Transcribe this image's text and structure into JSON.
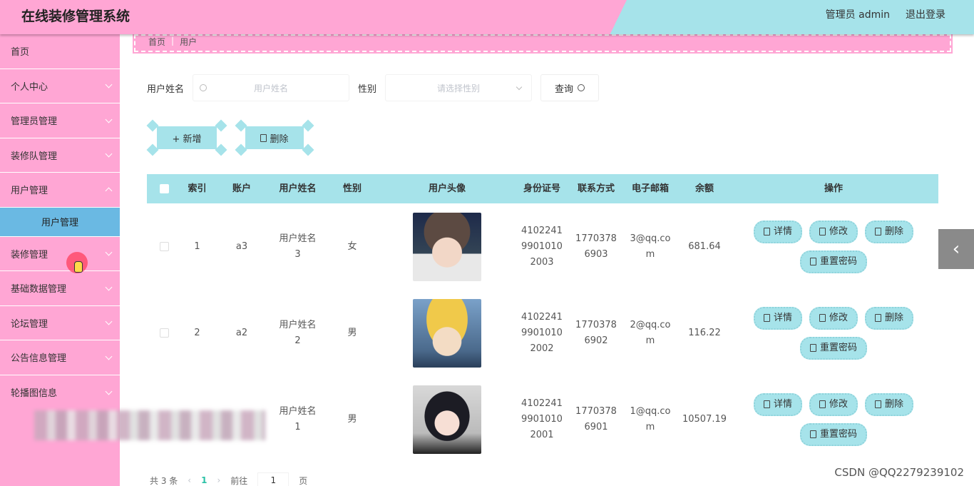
{
  "app": {
    "title": "在线装修管理系统"
  },
  "header": {
    "user_label": "管理员 admin",
    "logout_label": "退出登录"
  },
  "sidebar": {
    "items": [
      {
        "label": "首页"
      },
      {
        "label": "个人中心"
      },
      {
        "label": "管理员管理"
      },
      {
        "label": "装修队管理"
      },
      {
        "label": "用户管理"
      }
    ],
    "sub_item": "用户管理",
    "items2": [
      {
        "label": "装修管理"
      },
      {
        "label": "基础数据管理"
      },
      {
        "label": "论坛管理"
      },
      {
        "label": "公告信息管理"
      },
      {
        "label": "轮播图信息"
      }
    ]
  },
  "breadcrumb": {
    "home": "首页",
    "current": "用户",
    "separator": "|"
  },
  "search": {
    "name_label": "用户姓名",
    "name_placeholder": "用户姓名",
    "gender_label": "性别",
    "gender_placeholder": "请选择性别",
    "query_label": "查询"
  },
  "actions": {
    "add_label": "+ 新增",
    "delete_label": "删除"
  },
  "table": {
    "headers": [
      "索引",
      "账户",
      "用户姓名",
      "性别",
      "用户头像",
      "身份证号",
      "联系方式",
      "电子邮箱",
      "余额",
      "操作"
    ],
    "rows": [
      {
        "index": "1",
        "account": "a3",
        "name": "用户姓名3",
        "gender": "女",
        "id_card": "410224199010102003",
        "phone": "17703786903",
        "email": "3@qq.com",
        "balance": "681.64"
      },
      {
        "index": "2",
        "account": "a2",
        "name": "用户姓名2",
        "gender": "男",
        "id_card": "410224199010102002",
        "phone": "17703786902",
        "email": "2@qq.com",
        "balance": "116.22"
      },
      {
        "index": "",
        "account": "",
        "name": "用户姓名1",
        "gender": "男",
        "id_card": "410224199010102001",
        "phone": "17703786901",
        "email": "1@qq.com",
        "balance": "10507.19"
      }
    ],
    "op_labels": {
      "detail": "详情",
      "edit": "修改",
      "delete": "删除",
      "reset": "重置密码"
    }
  },
  "pager": {
    "total": "共 3 条",
    "current_page": "1",
    "goto_label": "前往",
    "goto_value": "1",
    "page_unit": "页"
  },
  "watermark": "CSDN @QQ2279239102",
  "colors": {
    "pink": "#ffa6d4",
    "cyan": "#a6e3ea",
    "active_blue": "#6ab9e3"
  }
}
